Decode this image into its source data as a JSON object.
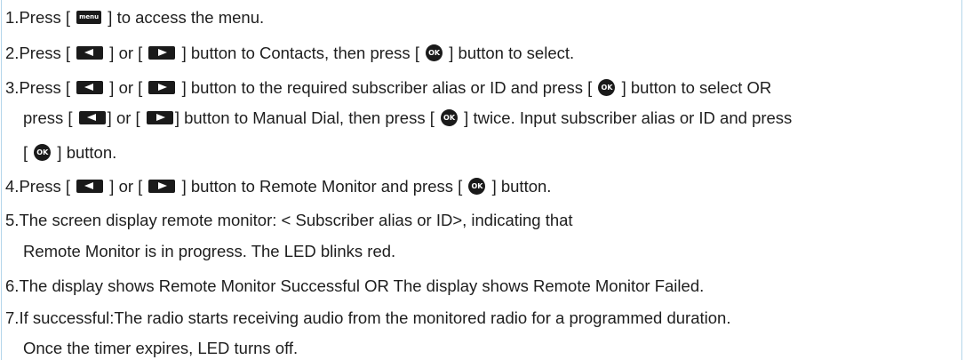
{
  "icons": {
    "menu_label": "menu",
    "ok_label": "OK"
  },
  "steps": [
    {
      "num": "1.",
      "a": "Press [ ",
      "b": " ] to access the menu."
    },
    {
      "num": "2.",
      "a": "Press [ ",
      "b": " ] or [ ",
      "c": " ] button to Contacts, then press [ ",
      "d": " ] button to select."
    },
    {
      "num": "3.",
      "a": "Press [ ",
      "b": " ] or [ ",
      "c": " ] button to the required subscriber alias or ID and press [ ",
      "d": " ] button to select OR",
      "line2a": "press [ ",
      "line2b": "] or [ ",
      "line2c": "] button to Manual Dial, then press [ ",
      "line2d": " ] twice. Input subscriber alias or ID and press",
      "line3a": "[ ",
      "line3b": " ] button."
    },
    {
      "num": "4.",
      "a": "Press [ ",
      "b": " ] or [ ",
      "c": " ] button to Remote Monitor and press [ ",
      "d": " ] button."
    },
    {
      "num": "5.",
      "a": "The screen display remote monitor: < Subscriber alias or ID>, indicating that",
      "line2": "Remote Monitor is in progress. The LED blinks red."
    },
    {
      "num": "6.",
      "a": "The display shows Remote Monitor Successful OR The display shows Remote Monitor Failed."
    },
    {
      "num": "7.",
      "a": "If successful:The radio starts receiving audio from the monitored radio for a programmed duration.",
      "line2": "Once the timer expires, LED turns off."
    }
  ]
}
